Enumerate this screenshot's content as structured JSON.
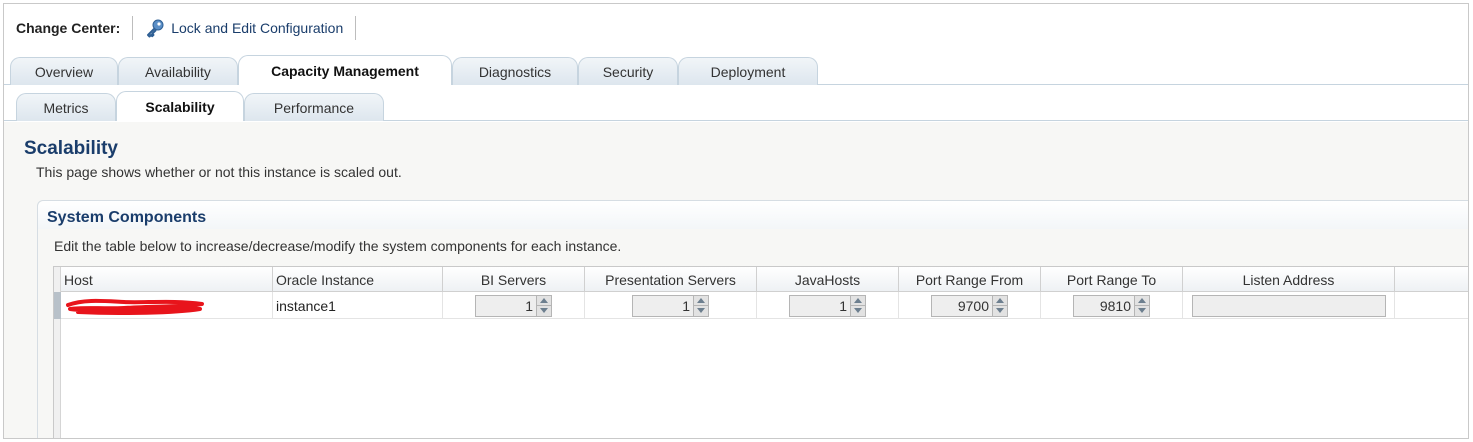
{
  "change_center": {
    "title": "Change Center:",
    "lock_label": "Lock and Edit Configuration",
    "lock_icon": "key-icon"
  },
  "main_tabs": [
    {
      "label": "Overview",
      "active": false
    },
    {
      "label": "Availability",
      "active": false
    },
    {
      "label": "Capacity Management",
      "active": true
    },
    {
      "label": "Diagnostics",
      "active": false
    },
    {
      "label": "Security",
      "active": false
    },
    {
      "label": "Deployment",
      "active": false
    }
  ],
  "sub_tabs": [
    {
      "label": "Metrics",
      "active": false
    },
    {
      "label": "Scalability",
      "active": true
    },
    {
      "label": "Performance",
      "active": false
    }
  ],
  "page": {
    "title": "Scalability",
    "description": "This page shows whether or not this instance is scaled out."
  },
  "section": {
    "title": "System Components",
    "description": "Edit the table below to increase/decrease/modify the system components for each instance."
  },
  "table": {
    "columns": [
      "Host",
      "Oracle Instance",
      "BI Servers",
      "Presentation Servers",
      "JavaHosts",
      "Port Range From",
      "Port Range To",
      "Listen Address"
    ],
    "rows": [
      {
        "host": "",
        "oracle_instance": "instance1",
        "bi_servers": "1",
        "presentation_servers": "1",
        "javahosts": "1",
        "port_range_from": "9700",
        "port_range_to": "9810",
        "listen_address": ""
      }
    ]
  },
  "colors": {
    "title_blue": "#1a3d6b",
    "redaction_red": "#e8141b"
  }
}
